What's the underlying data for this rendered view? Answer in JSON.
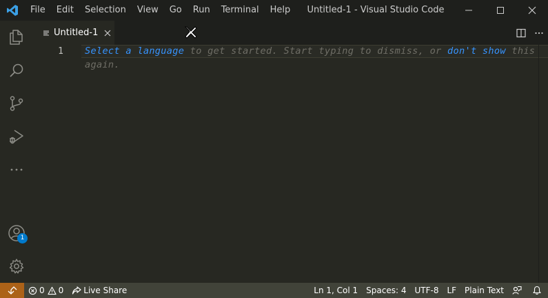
{
  "titlebar": {
    "menu": [
      "File",
      "Edit",
      "Selection",
      "View",
      "Go",
      "Run",
      "Terminal",
      "Help"
    ],
    "window_title": "Untitled-1 - Visual Studio Code"
  },
  "activitybar": {
    "items": [
      "explorer-icon",
      "search-icon",
      "source-control-icon",
      "run-debug-icon",
      "more-icon"
    ],
    "accounts_badge": "1"
  },
  "tabs": [
    {
      "label": "Untitled-1",
      "active": true
    }
  ],
  "editor": {
    "line_number": "1",
    "hint_link1": "Select a language",
    "hint_mid": " to get started. Start typing to dismiss, or ",
    "hint_link2": "don't show",
    "hint_end": " this again."
  },
  "statusbar": {
    "errors": "0",
    "warnings": "0",
    "live_share": "Live Share",
    "position": "Ln 1, Col 1",
    "spaces": "Spaces: 4",
    "encoding": "UTF-8",
    "eol": "LF",
    "language": "Plain Text"
  },
  "colors": {
    "background": "#272822",
    "titlebar": "#1e1f1c",
    "statusbar": "#414339",
    "remote": "#ac6218",
    "link": "#3794ff",
    "badge": "#007acc"
  }
}
